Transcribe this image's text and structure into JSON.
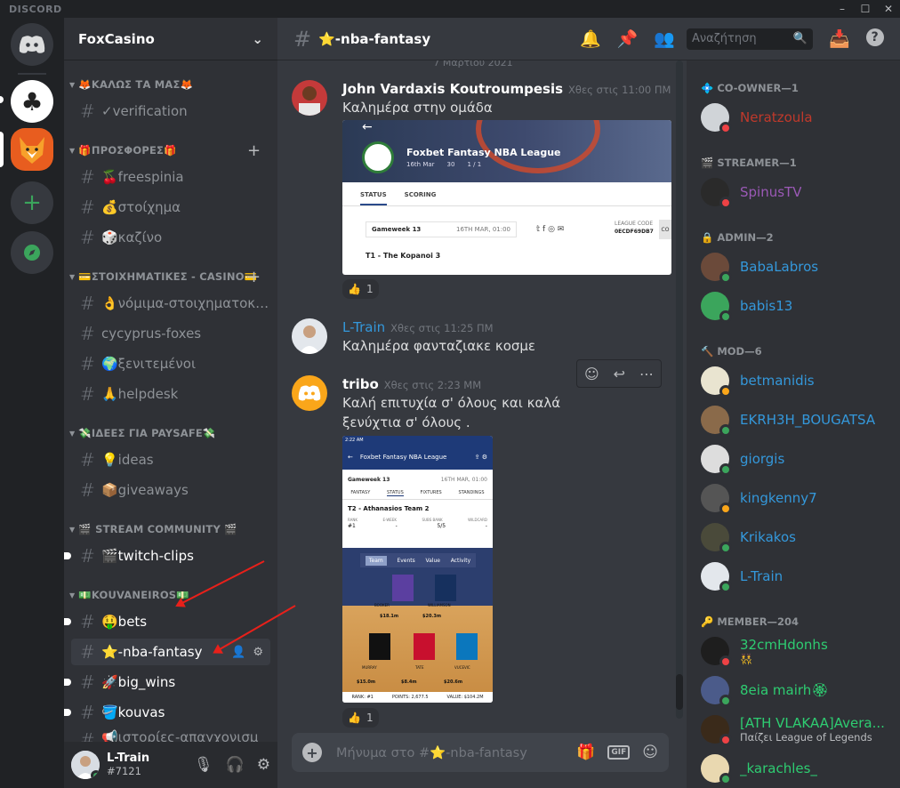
{
  "app": {
    "brand": "DISCORD",
    "window_controls": [
      "–",
      "☐",
      "✕"
    ]
  },
  "guild": {
    "name": "FoxCasino"
  },
  "channel": {
    "name": "⭐-nba-fantasy",
    "search_placeholder": "Αναζήτηση"
  },
  "categories": [
    {
      "label": "🦊ΚΑΛΩΣ ΤΑ ΜΑΣ🦊"
    },
    {
      "label": "🎁ΠΡΟΣΦΟΡΕΣ🎁"
    },
    {
      "label": "💳ΣΤΟΙΧΗΜΑΤΙΚΕΣ - CASINO💳"
    },
    {
      "label": "💸ΙΔΕΕΣ ΓΙΑ PAYSAFE💸"
    },
    {
      "label": "🎬 STREAM COMMUNITY 🎬"
    },
    {
      "label": "💵KOUVANEIROS💵"
    }
  ],
  "channels": [
    {
      "label": "✓verification"
    },
    {
      "label": "🍒freespinia"
    },
    {
      "label": "💰στοίχημα"
    },
    {
      "label": "🎲καζίνο"
    },
    {
      "label": "👌νόμιμα-στοιχηματοκαζίνο"
    },
    {
      "label": "cycyprus-foxes"
    },
    {
      "label": "🌍ξενιτεμένοι"
    },
    {
      "label": "🙏helpdesk"
    },
    {
      "label": "💡ideas"
    },
    {
      "label": "📦giveaways"
    },
    {
      "label": "🎬twitch-clips"
    },
    {
      "label": "🤑bets"
    },
    {
      "label": "⭐-nba-fantasy"
    },
    {
      "label": "🚀big_wins"
    },
    {
      "label": "🪣kouvas"
    },
    {
      "label": "📢ιστορίες-απαγχονισμ"
    }
  ],
  "user": {
    "name": "L-Train",
    "tag": "#7121"
  },
  "messages": [
    {
      "author": "John Vardaxis Koutroumpesis",
      "time": "Χθες στις 11:00 ΠΜ",
      "text": "Καλημέρα στην ομάδα",
      "reaction": {
        "emoji": "👍",
        "count": "1"
      }
    },
    {
      "author": "L-Train",
      "time": "Χθες στις 11:25 ΠΜ",
      "text": "Καλημέρα φανταζιακε κοσμε"
    },
    {
      "author": "tribo",
      "time": "Χθες στις 2:23 ΜΜ",
      "text": "Καλή επιτυχία σ' όλους και καλά ξενύχτια σ' όλους .",
      "reaction": {
        "emoji": "👍",
        "count": "1"
      }
    }
  ],
  "date_divider": "7 Μαρτίου 2021",
  "embed1": {
    "title": "Foxbet Fantasy NBA League",
    "meta1": "16th Mar",
    "meta2": "30",
    "meta3": "1 / 1",
    "tab_status": "STATUS",
    "tab_scoring": "SCORING",
    "gameweek": "Gameweek 13",
    "deadline": "16TH MAR, 01:00",
    "league_code_label": "LEAGUE CODE",
    "league_code": "0ECDF69DB7",
    "copy": "CO",
    "team": "T1 - The Kopanoi 3"
  },
  "embed2": {
    "clock": "2:22 AM",
    "title": "Foxbet Fantasy NBA League",
    "gameweek": "Gameweek 13",
    "deadline": "16TH MAR, 01:00",
    "tabs": [
      "FANTASY",
      "STATUS",
      "FIXTURES",
      "STANDINGS"
    ],
    "team": "T2 - Athanasios Team 2",
    "stats_labels": [
      "RANK",
      "E-WEEK",
      "SUBS BANK",
      "WILDCARD"
    ],
    "stats_values": [
      "#1",
      "-",
      "5/5",
      "-"
    ],
    "view_tabs": [
      "Team",
      "Events",
      "Value",
      "Activity"
    ],
    "players": [
      "BOOKER",
      "WILLIAMSON",
      "MURRAY",
      "TATE",
      "VUCEVIC"
    ],
    "prices": [
      "$18.1m",
      "$20.3m",
      "$15.0m",
      "$8.4m",
      "$20.6m"
    ],
    "footer": [
      "RANK: #1",
      "POINTS: 2,677.5",
      "VALUE: $104.2M"
    ]
  },
  "composer": {
    "placeholder": "Μήνυμα στο #⭐-nba-fantasy"
  },
  "member_groups": [
    {
      "label": "CO-OWNER—1",
      "icon": "💠"
    },
    {
      "label": "STREAMER—1",
      "icon": "🎬"
    },
    {
      "label": "ADMIN—2",
      "icon": "🔒"
    },
    {
      "label": "MOD—6",
      "icon": "🔨"
    },
    {
      "label": "MEMBER—204",
      "icon": "🔑"
    }
  ],
  "members": [
    {
      "name": "Neratzoula",
      "color": "#c0392b",
      "status": "dnd"
    },
    {
      "name": "SpinusTV",
      "color": "#9b59b6",
      "status": "dnd"
    },
    {
      "name": "BabaLabros",
      "color": "#3498db",
      "status": "online"
    },
    {
      "name": "babis13",
      "color": "#3498db",
      "status": "online"
    },
    {
      "name": "betmanidis",
      "color": "#3498db",
      "status": "idle"
    },
    {
      "name": "EKRH3H_BOUGATSA",
      "color": "#3498db",
      "status": "online"
    },
    {
      "name": "giorgis",
      "color": "#3498db",
      "status": "online"
    },
    {
      "name": "kingkenny7",
      "color": "#3498db",
      "status": "idle"
    },
    {
      "name": "Krikakos",
      "color": "#3498db",
      "status": "online"
    },
    {
      "name": "L-Train",
      "color": "#3498db",
      "status": "online"
    },
    {
      "name": "32cmHdonhs",
      "color": "#2ecc71",
      "status": "dnd",
      "sub": "👯"
    },
    {
      "name": "8eia mairh🏵",
      "color": "#2ecc71",
      "status": "online"
    },
    {
      "name": "[ATH VLAKAA]Avera...",
      "color": "#2ecc71",
      "status": "dnd",
      "sub": "Παίζει League of Legends"
    },
    {
      "name": "_karachles_",
      "color": "#2ecc71",
      "status": "online"
    }
  ]
}
